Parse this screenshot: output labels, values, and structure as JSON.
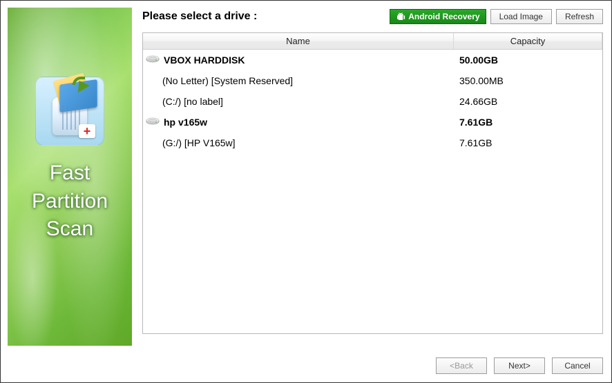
{
  "sidebar": {
    "title_line1": "Fast",
    "title_line2": "Partition",
    "title_line3": "Scan"
  },
  "header": {
    "title": "Please select a drive :",
    "android_button": "Android Recovery",
    "load_image_button": "Load Image",
    "refresh_button": "Refresh"
  },
  "table": {
    "columns": {
      "name": "Name",
      "capacity": "Capacity"
    },
    "drives": [
      {
        "name": "VBOX HARDDISK",
        "capacity": "50.00GB",
        "partitions": [
          {
            "name": "(No Letter) [System Reserved]",
            "capacity": "350.00MB"
          },
          {
            "name": "(C:/) [no label]",
            "capacity": "24.66GB"
          }
        ]
      },
      {
        "name": "hp v165w",
        "capacity": "7.61GB",
        "partitions": [
          {
            "name": "(G:/) [HP V165w]",
            "capacity": "7.61GB"
          }
        ]
      }
    ]
  },
  "footer": {
    "back": "<Back",
    "next": "Next>",
    "cancel": "Cancel"
  }
}
